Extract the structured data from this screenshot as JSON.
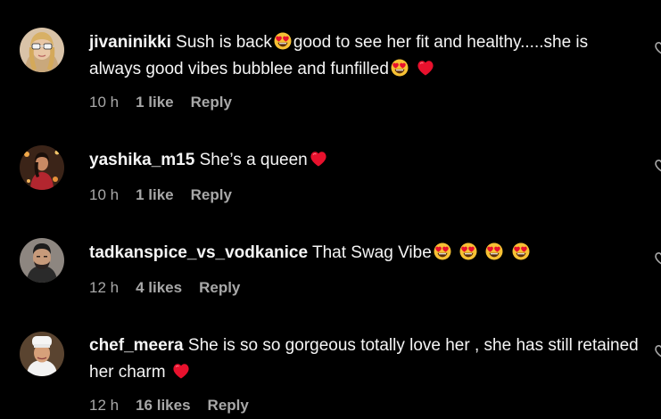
{
  "comments": [
    {
      "username": "jivaninikki",
      "segments": [
        "Sush is back",
        "good to see her fit and healthy.....she is always good vibes bubblee and funfilled"
      ],
      "time": "10 h",
      "likes": "1 like",
      "reply": "Reply"
    },
    {
      "username": "yashika_m15",
      "segments": [
        "She’s a queen"
      ],
      "time": "10 h",
      "likes": "1 like",
      "reply": "Reply"
    },
    {
      "username": "tadkanspice_vs_vodkanice",
      "segments": [
        "That Swag Vibe"
      ],
      "time": "12 h",
      "likes": "4 likes",
      "reply": "Reply"
    },
    {
      "username": "chef_meera",
      "segments": [
        "She is so so gorgeous totally love her , she has still retained her charm"
      ],
      "time": "12 h",
      "likes": "16 likes",
      "reply": "Reply"
    }
  ],
  "icons": {
    "heart_eyes_emoji": "heart-eyes-emoji",
    "red_heart_emoji": "red-heart-emoji",
    "like_button": "heart-outline-icon"
  },
  "colors": {
    "background": "#000000",
    "text": "#f5f5f5",
    "secondary_text": "#a8a8a8",
    "heart_red": "#e8112d",
    "emoji_yellow": "#ffcc33"
  }
}
